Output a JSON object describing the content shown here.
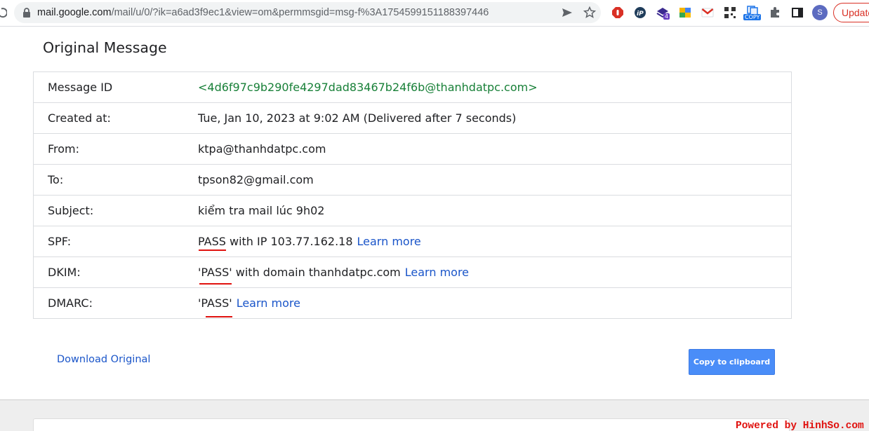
{
  "browser": {
    "url_host": "mail.google.com",
    "url_path": "/mail/u/0/?ik=a6ad3f9ec1&view=om&permmsgid=msg-f%3A1754599151188397446",
    "extension_badges": [
      "4",
      "COPY"
    ],
    "avatar_letter": "S",
    "update_label": "Update"
  },
  "page": {
    "title": "Original Message",
    "rows": [
      {
        "label": "Message ID",
        "value": "<4d6f97c9b290fe4297dad83467b24f6b@thanhdatpc.com>"
      },
      {
        "label": "Created at:",
        "value": "Tue, Jan 10, 2023 at 9:02 AM (Delivered after 7 seconds)"
      },
      {
        "label": "From:",
        "value": "ktpa@thanhdatpc.com"
      },
      {
        "label": "To:",
        "value": "tpson82@gmail.com"
      },
      {
        "label": "Subject:",
        "value": "kiểm tra mail lúc 9h02"
      },
      {
        "label": "SPF:",
        "value_status": "PASS",
        "value_rest": " with IP 103.77.162.18",
        "learn_more": "Learn more"
      },
      {
        "label": "DKIM:",
        "value_status": "'PASS'",
        "value_rest": " with domain thanhdatpc.com",
        "learn_more": "Learn more"
      },
      {
        "label": "DMARC:",
        "value_status": "'PASS'",
        "value_rest": "",
        "learn_more": "Learn more"
      }
    ],
    "download_label": "Download Original",
    "copy_label": "Copy to clipboard"
  },
  "watermark": "Powered by HinhSo.com",
  "colors": {
    "link": "#1a55c9",
    "message_id": "#188038",
    "annotation_underline": "#e0120f",
    "copy_button": "#4a8df8"
  }
}
